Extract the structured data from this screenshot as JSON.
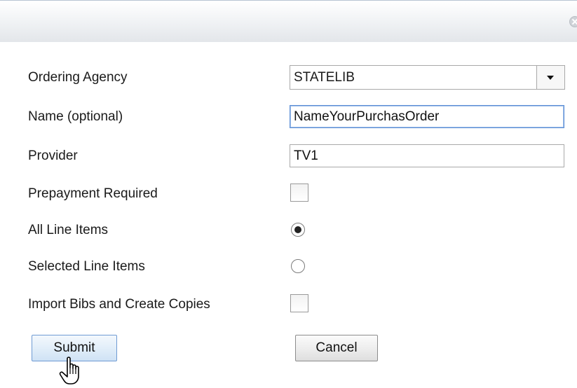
{
  "dialog": {
    "close_icon": "close-circle-icon"
  },
  "form": {
    "ordering_agency": {
      "label": "Ordering Agency",
      "value": "STATELIB"
    },
    "name": {
      "label": "Name (optional)",
      "value": "NameYourPurchasOrder"
    },
    "provider": {
      "label": "Provider",
      "value": "TV1"
    },
    "prepayment": {
      "label": "Prepayment Required",
      "checked": false
    },
    "all_line_items": {
      "label": "All Line Items",
      "selected": true
    },
    "selected_line_items": {
      "label": "Selected Line Items",
      "selected": false
    },
    "import_bibs": {
      "label": "Import Bibs and Create Copies",
      "checked": false
    }
  },
  "buttons": {
    "submit": "Submit",
    "cancel": "Cancel"
  },
  "cursor": "hand-pointer-icon"
}
